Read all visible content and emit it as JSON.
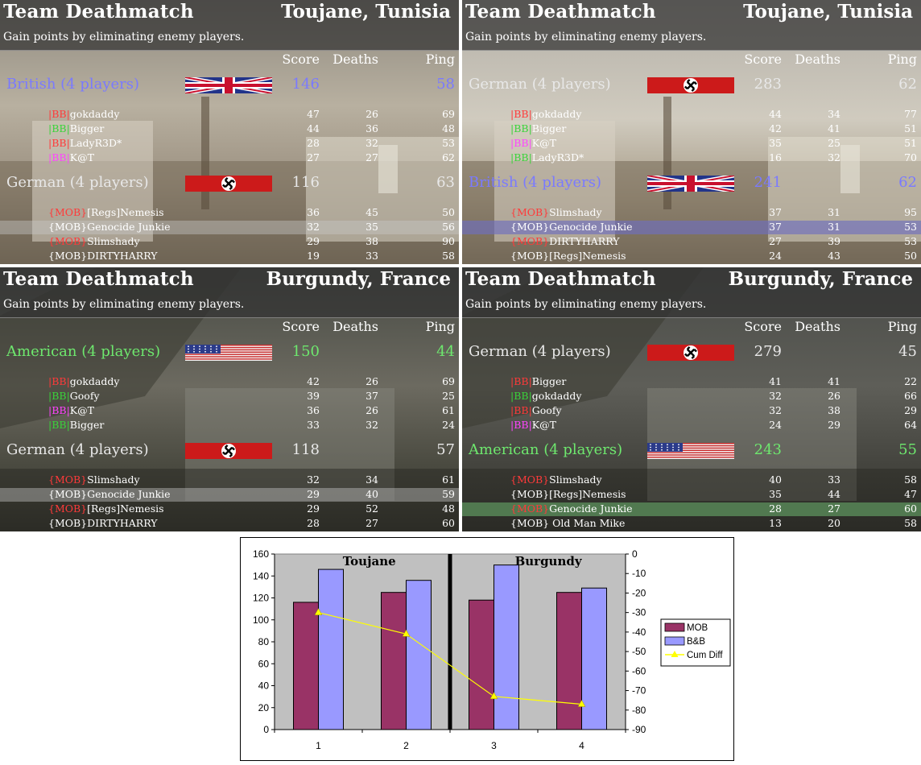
{
  "panels": [
    {
      "mode": "Team Deathmatch",
      "map": "Toujane, Tunisia",
      "description": "Gain points by eliminating enemy players.",
      "headers": {
        "score": "Score",
        "deaths": "Deaths",
        "ping": "Ping"
      },
      "teams": [
        {
          "name": "British (4 players)",
          "score": "146",
          "ping": "58",
          "color": "#7a7aff",
          "flag": "british",
          "players": [
            {
              "prefix": "|BB|",
              "name": "gokdaddy",
              "score": "47",
              "deaths": "26",
              "ping": "69"
            },
            {
              "prefix": "|BB|",
              "name": "Bigger",
              "score": "44",
              "deaths": "36",
              "ping": "48"
            },
            {
              "prefix": "|BB|",
              "name": "LadyR3D*",
              "score": "28",
              "deaths": "32",
              "ping": "53"
            },
            {
              "prefix": "|BB|",
              "name": "K@T",
              "score": "27",
              "deaths": "27",
              "ping": "62"
            }
          ]
        },
        {
          "name": "German (4 players)",
          "score": "116",
          "ping": "63",
          "color": "#e8e8e8",
          "flag": "german",
          "players": [
            {
              "prefix": "{MOB}",
              "name": "[Regs]Nemesis",
              "score": "36",
              "deaths": "45",
              "ping": "50"
            },
            {
              "prefix": "{MOB}",
              "name": "Genocide Junkie",
              "score": "32",
              "deaths": "35",
              "ping": "56"
            },
            {
              "prefix": "{MOB}",
              "name": "Slimshady",
              "score": "29",
              "deaths": "38",
              "ping": "90"
            },
            {
              "prefix": "{MOB}",
              "name": "DIRTYHARRY",
              "score": "19",
              "deaths": "33",
              "ping": "58"
            }
          ]
        }
      ]
    },
    {
      "mode": "Team Deathmatch",
      "map": "Toujane, Tunisia",
      "description": "Gain points by eliminating enemy players.",
      "headers": {
        "score": "Score",
        "deaths": "Deaths",
        "ping": "Ping"
      },
      "teams": [
        {
          "name": "German (4 players)",
          "score": "283",
          "ping": "62",
          "color": "#e8e8e8",
          "flag": "german",
          "players": [
            {
              "prefix": "|BB|",
              "name": "gokdaddy",
              "score": "44",
              "deaths": "34",
              "ping": "77"
            },
            {
              "prefix": "|BB|",
              "name": "Bigger",
              "score": "42",
              "deaths": "41",
              "ping": "51"
            },
            {
              "prefix": "|BB|",
              "name": "K@T",
              "score": "35",
              "deaths": "25",
              "ping": "51"
            },
            {
              "prefix": "|BB|",
              "name": "LadyR3D*",
              "score": "16",
              "deaths": "32",
              "ping": "70"
            }
          ]
        },
        {
          "name": "British (4 players)",
          "score": "241",
          "ping": "62",
          "color": "#7a7aff",
          "flag": "british",
          "players": [
            {
              "prefix": "{MOB}",
              "name": "Slimshady",
              "score": "37",
              "deaths": "31",
              "ping": "95"
            },
            {
              "prefix": "{MOB}",
              "name": "Genocide Junkie",
              "score": "37",
              "deaths": "31",
              "ping": "53"
            },
            {
              "prefix": "{MOB}",
              "name": "DIRTYHARRY",
              "score": "27",
              "deaths": "39",
              "ping": "53"
            },
            {
              "prefix": "{MOB}",
              "name": "[Regs]Nemesis",
              "score": "24",
              "deaths": "43",
              "ping": "50"
            }
          ]
        }
      ]
    },
    {
      "mode": "Team Deathmatch",
      "map": "Burgundy, France",
      "description": "Gain points by eliminating enemy players.",
      "headers": {
        "score": "Score",
        "deaths": "Deaths",
        "ping": "Ping"
      },
      "teams": [
        {
          "name": "American (4 players)",
          "score": "150",
          "ping": "44",
          "color": "#6ee86e",
          "flag": "american",
          "players": [
            {
              "prefix": "|BB|",
              "name": "gokdaddy",
              "score": "42",
              "deaths": "26",
              "ping": "69"
            },
            {
              "prefix": "|BB|",
              "name": "Goofy",
              "score": "39",
              "deaths": "37",
              "ping": "25"
            },
            {
              "prefix": "|BB|",
              "name": "K@T",
              "score": "36",
              "deaths": "26",
              "ping": "61"
            },
            {
              "prefix": "|BB|",
              "name": "Bigger",
              "score": "33",
              "deaths": "32",
              "ping": "24"
            }
          ]
        },
        {
          "name": "German (4 players)",
          "score": "118",
          "ping": "57",
          "color": "#e8e8e8",
          "flag": "german",
          "players": [
            {
              "prefix": "{MOB}",
              "name": "Slimshady",
              "score": "32",
              "deaths": "34",
              "ping": "61"
            },
            {
              "prefix": "{MOB}",
              "name": "Genocide Junkie",
              "score": "29",
              "deaths": "40",
              "ping": "59"
            },
            {
              "prefix": "{MOB}",
              "name": "[Regs]Nemesis",
              "score": "29",
              "deaths": "52",
              "ping": "48"
            },
            {
              "prefix": "{MOB}",
              "name": "DIRTYHARRY",
              "score": "28",
              "deaths": "27",
              "ping": "60"
            }
          ]
        }
      ]
    },
    {
      "mode": "Team Deathmatch",
      "map": "Burgundy, France",
      "description": "Gain points by eliminating enemy players.",
      "headers": {
        "score": "Score",
        "deaths": "Deaths",
        "ping": "Ping"
      },
      "teams": [
        {
          "name": "German (4 players)",
          "score": "279",
          "ping": "45",
          "color": "#e8e8e8",
          "flag": "german",
          "players": [
            {
              "prefix": "|BB|",
              "name": "Bigger",
              "score": "41",
              "deaths": "41",
              "ping": "22"
            },
            {
              "prefix": "|BB|",
              "name": "gokdaddy",
              "score": "32",
              "deaths": "26",
              "ping": "66"
            },
            {
              "prefix": "|BB|",
              "name": "Goofy",
              "score": "32",
              "deaths": "38",
              "ping": "29"
            },
            {
              "prefix": "|BB|",
              "name": "K@T",
              "score": "24",
              "deaths": "29",
              "ping": "64"
            }
          ]
        },
        {
          "name": "American (4 players)",
          "score": "243",
          "ping": "55",
          "color": "#6ee86e",
          "flag": "american",
          "players": [
            {
              "prefix": "{MOB}",
              "name": "Slimshady",
              "score": "40",
              "deaths": "33",
              "ping": "58"
            },
            {
              "prefix": "{MOB}",
              "name": "[Regs]Nemesis",
              "score": "35",
              "deaths": "44",
              "ping": "47"
            },
            {
              "prefix": "{MOB}",
              "name": "Genocide Junkie",
              "score": "28",
              "deaths": "27",
              "ping": "60"
            },
            {
              "prefix": "{MOB}",
              "name": " Old Man Mike",
              "score": "13",
              "deaths": "20",
              "ping": "58"
            }
          ]
        }
      ]
    }
  ],
  "chart_data": {
    "type": "bar",
    "categories": [
      "1",
      "2",
      "3",
      "4"
    ],
    "annotations": [
      "Toujane",
      "Burgundy"
    ],
    "series": [
      {
        "name": "MOB",
        "type": "bar",
        "axis": "left",
        "color": "#993366",
        "values": [
          116,
          125,
          118,
          125
        ]
      },
      {
        "name": "B&B",
        "type": "bar",
        "axis": "left",
        "color": "#9999ff",
        "values": [
          146,
          136,
          150,
          129
        ]
      },
      {
        "name": "Cum Diff",
        "type": "line",
        "axis": "right",
        "color": "#ffff00",
        "values": [
          -30,
          -41,
          -73,
          -77
        ]
      }
    ],
    "ylim": [
      0,
      160
    ],
    "yticks": [
      "0",
      "20",
      "40",
      "60",
      "80",
      "100",
      "120",
      "140",
      "160"
    ],
    "y2lim": [
      -90,
      0
    ],
    "y2ticks": [
      "0",
      "-10",
      "-20",
      "-30",
      "-40",
      "-50",
      "-60",
      "-70",
      "-80",
      "-90"
    ],
    "legend": "right",
    "grid": false,
    "plot_background": "#c0c0c0"
  }
}
